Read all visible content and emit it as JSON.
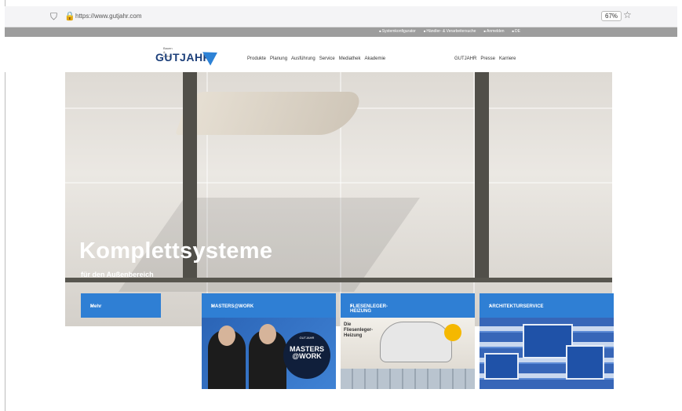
{
  "browser": {
    "url": "https://www.gutjahr.com",
    "zoom": "67%"
  },
  "topbar": {
    "links": [
      "Systemkonfigurator",
      "Händler- & Verarbeitersuche",
      "Anmelden",
      "DE"
    ]
  },
  "header": {
    "logo_text": "GUTJAHR",
    "logo_small": "Bauen & mehr",
    "menu_main": [
      "Produkte",
      "Planung",
      "Ausführung",
      "Service",
      "Mediathek",
      "Akademie"
    ],
    "menu_secondary": [
      "GUTJAHR",
      "Presse",
      "Karriere"
    ]
  },
  "hero": {
    "title": "Komplettsysteme",
    "subtitle": "für den Außenbereich",
    "more_button": "Mehr"
  },
  "cards": [
    {
      "title": "MASTERS@WORK",
      "badge_line1": "MASTERS",
      "badge_line2": "@WORK",
      "badge_brand": "GUTJAHR"
    },
    {
      "title": "FLIESENLEGER-HEIZUNG",
      "image_text": "Die Fliesenleger-Heizung"
    },
    {
      "title": "ARCHITEKTURSERVICE"
    }
  ],
  "colors": {
    "accent_blue": "#2f7fd4",
    "brand_navy": "#1c3f7a",
    "topstrip": "#9d9d9d"
  },
  "icons": {
    "shield": "shield-icon",
    "lock": "lock-icon",
    "star": "star-icon",
    "arrow": "chevron-right-icon"
  }
}
